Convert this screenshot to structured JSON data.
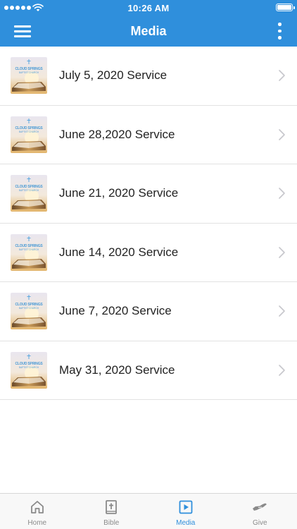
{
  "status_bar": {
    "time": "10:26 AM"
  },
  "nav": {
    "title": "Media"
  },
  "media_items": [
    {
      "label": "July 5, 2020 Service"
    },
    {
      "label": "June 28,2020 Service"
    },
    {
      "label": "June 21, 2020 Service"
    },
    {
      "label": "June 14, 2020 Service"
    },
    {
      "label": "June 7, 2020 Service"
    },
    {
      "label": "May 31, 2020 Service"
    }
  ],
  "thumbnail": {
    "line1": "CLOUD SPRINGS",
    "line2": "BAPTIST CHURCH"
  },
  "tabs": [
    {
      "label": "Home",
      "icon": "home-icon"
    },
    {
      "label": "Bible",
      "icon": "bible-icon"
    },
    {
      "label": "Media",
      "icon": "play-icon",
      "active": true
    },
    {
      "label": "Give",
      "icon": "give-hand-icon"
    }
  ],
  "colors": {
    "brand": "#2f8fdc",
    "tab_inactive": "#8a8a8a"
  }
}
